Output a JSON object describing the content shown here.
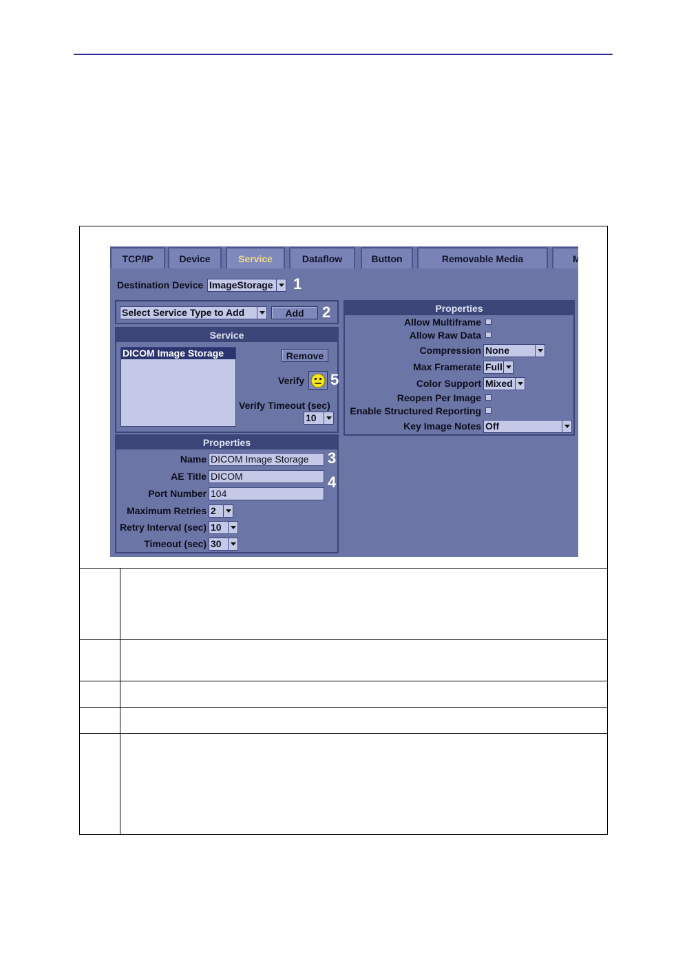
{
  "tabs": [
    "TCP/IP",
    "Device",
    "Service",
    "Dataflow",
    "Button",
    "Removable Media",
    "M"
  ],
  "destination": {
    "label": "Destination Device",
    "value": "ImageStorage"
  },
  "callouts": [
    "1",
    "2",
    "3",
    "4",
    "5"
  ],
  "service_add": {
    "placeholder": "Select Service Type to Add",
    "add_label": "Add"
  },
  "service_group": {
    "title": "Service",
    "list_items": [
      "DICOM Image Storage"
    ],
    "remove_label": "Remove",
    "verify_label": "Verify",
    "verify_timeout_label": "Verify Timeout (sec)",
    "verify_timeout_value": "10"
  },
  "left_props": {
    "title": "Properties",
    "name_label": "Name",
    "name_value": "DICOM Image Storage",
    "ae_label": "AE Title",
    "ae_value": "DICOM",
    "port_label": "Port Number",
    "port_value": "104",
    "retries_label": "Maximum Retries",
    "retries_value": "2",
    "interval_label": "Retry Interval (sec)",
    "interval_value": "10",
    "timeout_label": "Timeout (sec)",
    "timeout_value": "30"
  },
  "right_props": {
    "title": "Properties",
    "allow_multiframe": "Allow Multiframe",
    "allow_raw": "Allow Raw Data",
    "compression_label": "Compression",
    "compression_value": "None",
    "framerate_label": "Max Framerate",
    "framerate_value": "Full",
    "color_label": "Color Support",
    "color_value": "Mixed",
    "reopen_label": "Reopen Per Image",
    "structured_label": "Enable Structured Reporting",
    "keynotes_label": "Key Image Notes",
    "keynotes_value": "Off"
  },
  "colors": {
    "panel_bg": "#6b75a6",
    "header_bg": "#3b4578",
    "active_tab_text": "#f0dc8a",
    "rule": "#2b2ba8"
  },
  "icons": {
    "verify_status": "neutral-face-icon"
  }
}
